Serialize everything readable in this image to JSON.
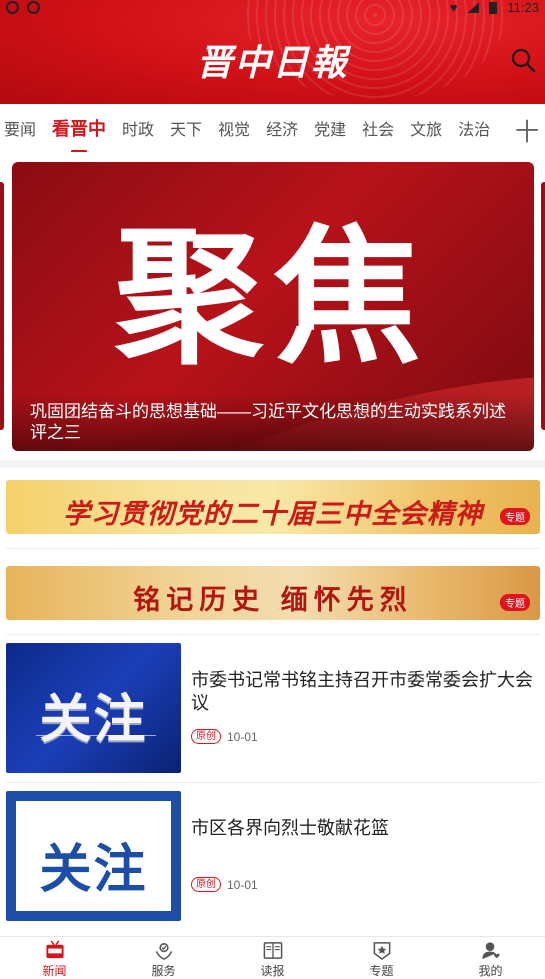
{
  "status_bar": {
    "time": "11:23"
  },
  "header": {
    "logo_text": "晋中日報"
  },
  "tabs": {
    "items": [
      "要闻",
      "看晋中",
      "时政",
      "天下",
      "视觉",
      "经济",
      "党建",
      "社会",
      "文旅",
      "法治"
    ],
    "active": "看晋中",
    "add_label": "十"
  },
  "banner": {
    "big_text": "聚焦",
    "caption": "巩固团结奋斗的思想基础——习近平文化思想的生动实践系列述评之三"
  },
  "topics": [
    {
      "text": "学习贯彻党的二十届三中全会精神",
      "tag": "专题"
    },
    {
      "text": "铭记历史  缅怀先烈",
      "tag": "专题"
    }
  ],
  "news": [
    {
      "thumb_text": "关注",
      "title": " 市委书记常书铭主持召开市委常委会扩大会议",
      "badge": "原创",
      "date": "10-01"
    },
    {
      "thumb_text": "关注",
      "title": "市区各界向烈士敬献花篮",
      "badge": "原创",
      "date": "10-01"
    }
  ],
  "bottom_nav": {
    "items": [
      {
        "label": "新闻",
        "icon": "news-icon"
      },
      {
        "label": "服务",
        "icon": "service-icon"
      },
      {
        "label": "读报",
        "icon": "newspaper-icon"
      },
      {
        "label": "专题",
        "icon": "topic-badge-icon"
      },
      {
        "label": "我的",
        "icon": "user-icon"
      }
    ],
    "active": "新闻"
  },
  "colors": {
    "brand_red": "#d4141b",
    "header_red": "#cf1016",
    "thumb_blue": "#1c4ea8"
  }
}
